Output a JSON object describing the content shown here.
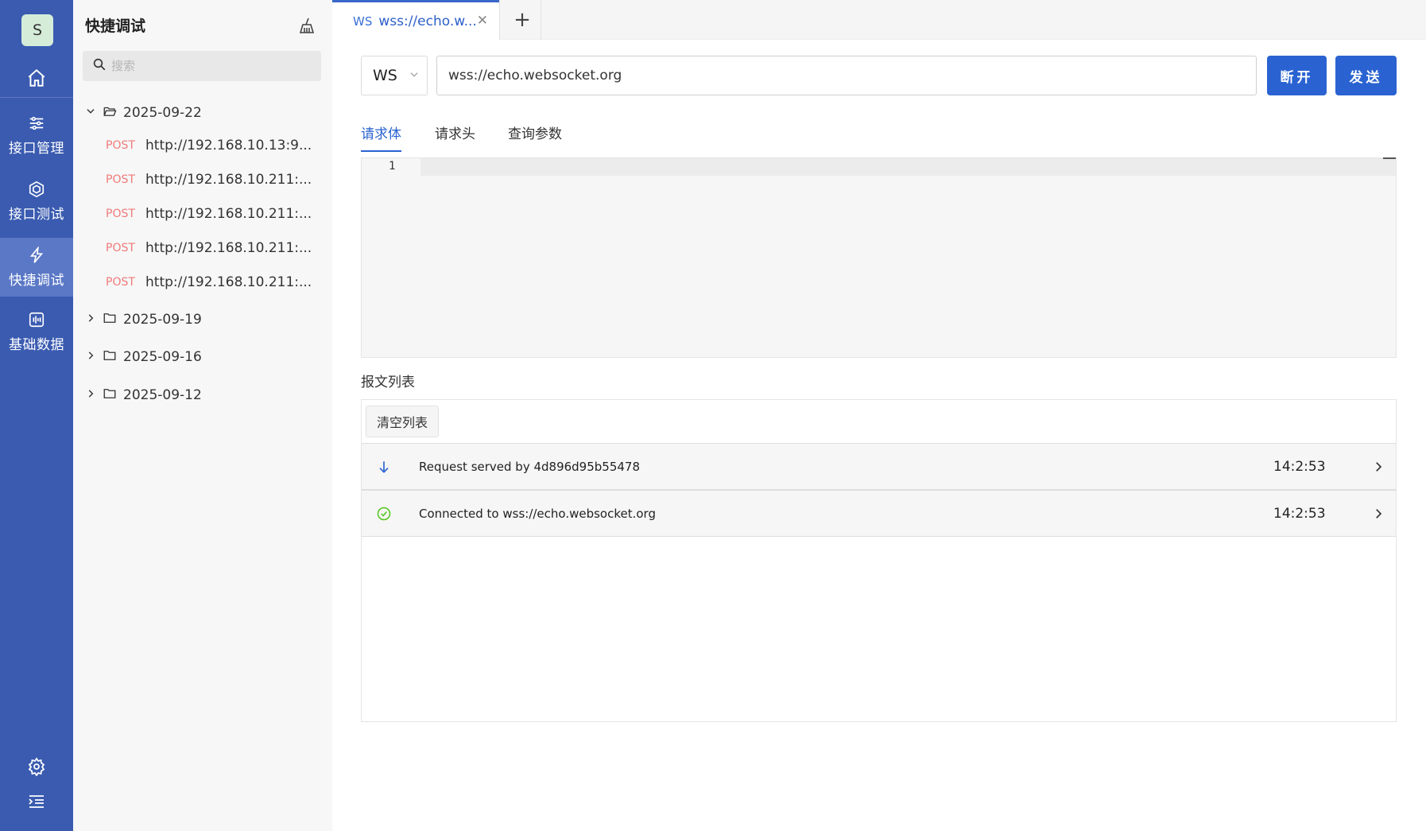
{
  "rail": {
    "avatar_letter": "S",
    "items": [
      {
        "label": "接口管理",
        "icon": "sliders-icon"
      },
      {
        "label": "接口测试",
        "icon": "hexagon-icon"
      },
      {
        "label": "快捷调试",
        "icon": "lightning-icon"
      },
      {
        "label": "基础数据",
        "icon": "data-icon"
      }
    ],
    "active_index": 2
  },
  "side": {
    "title": "快捷调试",
    "search_placeholder": "搜索",
    "folders": [
      {
        "date": "2025-09-22",
        "expanded": true,
        "requests": [
          {
            "method": "POST",
            "url": "http://192.168.10.13:9..."
          },
          {
            "method": "POST",
            "url": "http://192.168.10.211:..."
          },
          {
            "method": "POST",
            "url": "http://192.168.10.211:..."
          },
          {
            "method": "POST",
            "url": "http://192.168.10.211:..."
          },
          {
            "method": "POST",
            "url": "http://192.168.10.211:..."
          }
        ]
      },
      {
        "date": "2025-09-19",
        "expanded": false
      },
      {
        "date": "2025-09-16",
        "expanded": false
      },
      {
        "date": "2025-09-12",
        "expanded": false
      }
    ]
  },
  "tabs": {
    "active": {
      "protocol": "WS",
      "title": "wss://echo.w..."
    }
  },
  "request": {
    "method": "WS",
    "url": "wss://echo.websocket.org",
    "disconnect_label": "断开",
    "send_label": "发送"
  },
  "subtabs": [
    "请求体",
    "请求头",
    "查询参数"
  ],
  "editor": {
    "line_number": "1"
  },
  "messages": {
    "title": "报文列表",
    "clear_label": "清空列表",
    "rows": [
      {
        "icon": "arrow-down-icon",
        "text": "Request served by 4d896d95b55478",
        "time": "14:2:53"
      },
      {
        "icon": "check-circle-icon",
        "text": "Connected to wss://echo.websocket.org",
        "time": "14:2:53"
      }
    ]
  },
  "colors": {
    "rail_bg": "#3a5bb0",
    "accent": "#2a63d1",
    "method_post": "#f07a7a",
    "success": "#52c41a"
  }
}
